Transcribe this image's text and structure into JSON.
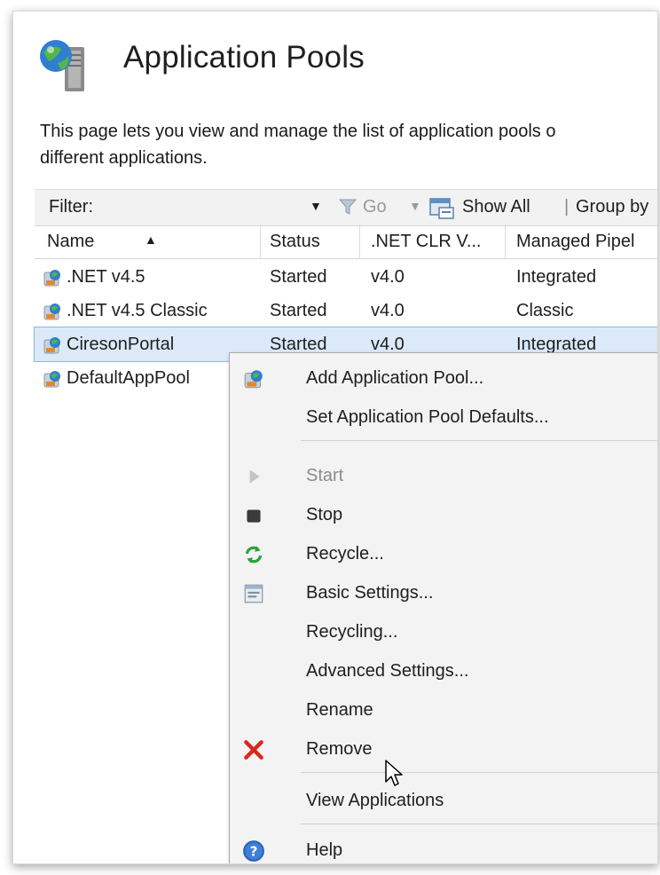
{
  "header": {
    "title": "Application Pools",
    "description_line1": "This page lets you view and manage the list of application pools o",
    "description_line2": "different applications."
  },
  "toolbar": {
    "filter_label": "Filter:",
    "go_label": "Go",
    "show_all_label": "Show All",
    "separator": "|",
    "group_by_label": "Group by"
  },
  "columns": {
    "name": "Name",
    "status": "Status",
    "clr": ".NET CLR V...",
    "pipeline": "Managed Pipel"
  },
  "rows": [
    {
      "name": ".NET v4.5",
      "status": "Started",
      "clr": "v4.0",
      "pipeline": "Integrated"
    },
    {
      "name": ".NET v4.5 Classic",
      "status": "Started",
      "clr": "v4.0",
      "pipeline": "Classic"
    },
    {
      "name": "CiresonPortal",
      "status": "Started",
      "clr": "v4.0",
      "pipeline": "Integrated",
      "selected": true
    },
    {
      "name": "DefaultAppPool",
      "status": "",
      "clr": "",
      "pipeline": ""
    }
  ],
  "context_menu": {
    "add_pool": "Add Application Pool...",
    "set_defaults": "Set Application Pool Defaults...",
    "start": "Start",
    "stop": "Stop",
    "recycle": "Recycle...",
    "basic_settings": "Basic Settings...",
    "recycling": "Recycling...",
    "advanced_settings": "Advanced Settings...",
    "rename": "Rename",
    "remove": "Remove",
    "view_applications": "View Applications",
    "help": "Help"
  },
  "icons": {
    "header": "app-pools-icon",
    "pool": "app-pool-icon",
    "filter": "funnel-icon",
    "show_all": "show-all-icon",
    "start": "play-icon",
    "stop": "stop-icon",
    "recycle": "recycle-icon",
    "basic_settings": "settings-icon",
    "remove": "remove-x-icon",
    "help": "help-icon"
  },
  "colors": {
    "selection_bg": "#dbe9f8",
    "remove_red": "#d8281c",
    "help_blue": "#2b63b8",
    "recycle_green": "#2aa23a"
  }
}
